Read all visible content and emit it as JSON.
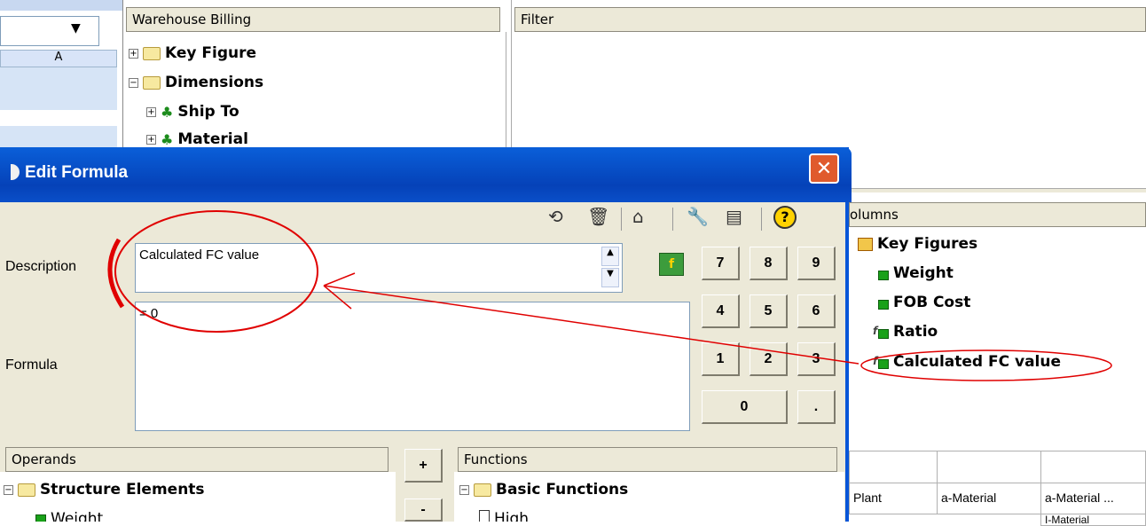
{
  "excel": {
    "column_a": "A"
  },
  "warehouse": {
    "title": "Warehouse Billing",
    "items": [
      "Key Figure",
      "Dimensions",
      "Ship To",
      "Material"
    ]
  },
  "filter": {
    "title": "Filter"
  },
  "columns": {
    "title": "olumns",
    "root": "Key Figures",
    "items": [
      "Weight",
      "FOB Cost",
      "Ratio",
      "Calculated FC value"
    ]
  },
  "dialog": {
    "title": "Edit Formula",
    "description_label": "Description",
    "description_value": "Calculated FC value",
    "formula_label": "Formula",
    "formula_value": "= 0",
    "keypad": [
      "7",
      "8",
      "9",
      "4",
      "5",
      "6",
      "1",
      "2",
      "3",
      "0",
      "."
    ],
    "operators": [
      "+",
      "-"
    ],
    "operands": {
      "title": "Operands",
      "group": "Structure Elements",
      "item": "Weight"
    },
    "functions": {
      "title": "Functions",
      "group": "Basic Functions",
      "item": "High"
    }
  },
  "grid": {
    "headers": [
      "Plant",
      "a-Material",
      "a-Material ..."
    ],
    "partial": "I-Material"
  },
  "colors": {
    "titlebar": "#0a5fd9",
    "annotation": "#e00000",
    "dialog_bg": "#ece9d8"
  }
}
